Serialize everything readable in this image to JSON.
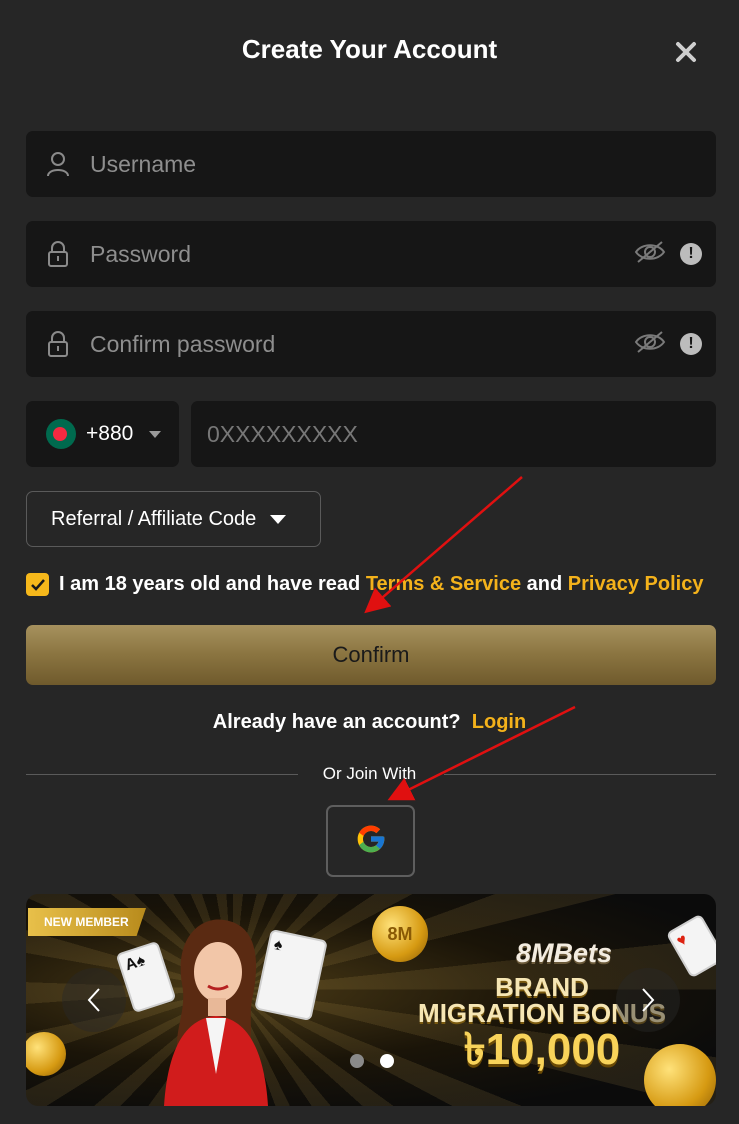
{
  "header": {
    "title": "Create Your Account",
    "close_icon": "close-icon"
  },
  "form": {
    "username_placeholder": "Username",
    "password_placeholder": "Password",
    "confirm_password_placeholder": "Confirm password",
    "country_code": "+880",
    "phone_placeholder": "0XXXXXXXXX",
    "referral_label": "Referral / Affiliate Code",
    "agree_text": "I am 18 years old and have read",
    "terms_link": "Terms & Service",
    "and_text": "and",
    "privacy_link": "Privacy Policy",
    "confirm_label": "Confirm"
  },
  "login": {
    "prompt": "Already have an account?",
    "link": "Login"
  },
  "social": {
    "or_join": "Or Join With",
    "google_icon": "google-icon"
  },
  "banner": {
    "badge": "NEW MEMBER",
    "brand": "8MBets",
    "line1": "BRAND",
    "line2": "MIGRATION BONUS",
    "amount": "৳10,000",
    "coin_text": "8M",
    "slides": 2,
    "active_slide": 2
  },
  "colors": {
    "background": "#262626",
    "field": "#161616",
    "accent": "#f4b21b",
    "confirm_button": "#8a7440",
    "annotation_arrow": "#e01010"
  }
}
